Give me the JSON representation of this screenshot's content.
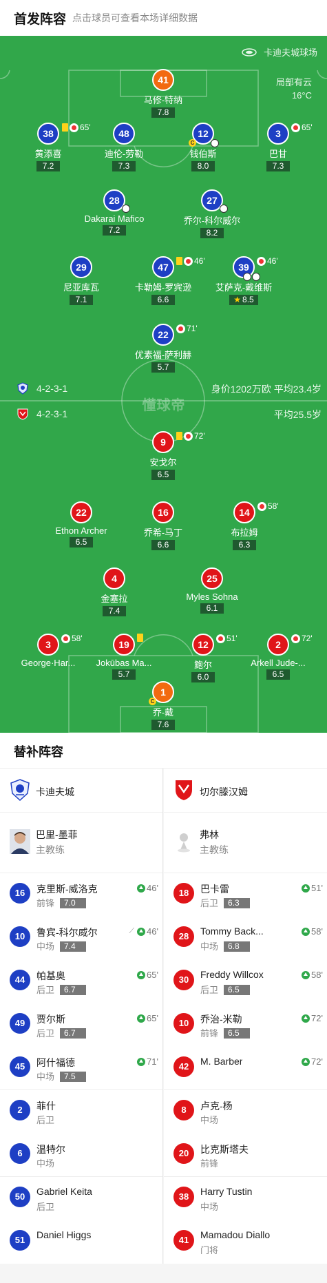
{
  "header": {
    "title": "首发阵容",
    "subtitle": "点击球员可查看本场详细数据"
  },
  "venue": "卡迪夫城球场",
  "weather": {
    "condition": "局部有云",
    "temp": "16°C"
  },
  "home": {
    "formation": "4-2-3-1",
    "meta": "身价1202万欧 平均23.4岁"
  },
  "away": {
    "formation": "4-2-3-1",
    "meta": "平均25.5岁"
  },
  "watermark": "懂球帝",
  "colors": {
    "pitch": "#31a74a",
    "home": "#1e3fc4",
    "away": "#e01519",
    "keeper": "#f26a10",
    "sub_in": "#2fa84a"
  },
  "home_players": [
    {
      "num": "41",
      "name": "马修-特纳",
      "rating": "7.8"
    },
    {
      "num": "38",
      "name": "黄添喜",
      "rating": "7.2",
      "minute": "65'"
    },
    {
      "num": "48",
      "name": "迪伦-劳勒",
      "rating": "7.3"
    },
    {
      "num": "12",
      "name": "钱伯斯",
      "rating": "8.0"
    },
    {
      "num": "3",
      "name": "巴甘",
      "rating": "7.3",
      "minute": "65'"
    },
    {
      "num": "28",
      "name": "Dakarai Mafico",
      "rating": "7.2"
    },
    {
      "num": "27",
      "name": "乔尔-科尔威尔",
      "rating": "8.2"
    },
    {
      "num": "29",
      "name": "尼亚库瓦",
      "rating": "7.1"
    },
    {
      "num": "47",
      "name": "卡勒姆-罗宾逊",
      "rating": "6.6",
      "minute": "46'"
    },
    {
      "num": "39",
      "name": "艾萨克-戴维斯",
      "rating": "8.5",
      "minute": "46'"
    },
    {
      "num": "22",
      "name": "优素福-萨利赫",
      "rating": "5.7",
      "minute": "71'"
    }
  ],
  "away_players": [
    {
      "num": "9",
      "name": "安戈尔",
      "rating": "6.5",
      "minute": "72'"
    },
    {
      "num": "22",
      "name": "Ethon Archer",
      "rating": "6.5"
    },
    {
      "num": "16",
      "name": "乔希-马丁",
      "rating": "6.6"
    },
    {
      "num": "14",
      "name": "布拉姆",
      "rating": "6.3",
      "minute": "58'"
    },
    {
      "num": "4",
      "name": "金塞拉",
      "rating": "7.4"
    },
    {
      "num": "25",
      "name": "Myles Sohna",
      "rating": "6.1"
    },
    {
      "num": "3",
      "name": "George·Har...",
      "minute": "58'"
    },
    {
      "num": "19",
      "name": "Jokūbas Ma...",
      "rating": "5.7"
    },
    {
      "num": "12",
      "name": "鲍尔",
      "rating": "6.0",
      "minute": "51'"
    },
    {
      "num": "2",
      "name": "Arkell Jude-...",
      "rating": "6.5",
      "minute": "72'"
    },
    {
      "num": "1",
      "name": "乔-戴",
      "rating": "7.6"
    }
  ],
  "subs": {
    "title": "替补阵容",
    "left": {
      "team": "卡迪夫城",
      "coach": {
        "name": "巴里-墨菲",
        "role": "主教练"
      },
      "players": [
        {
          "num": "16",
          "name": "克里斯-威洛克",
          "pos": "前锋",
          "rating": "7.0",
          "minute": "46'"
        },
        {
          "num": "10",
          "name": "鲁宾-科尔威尔",
          "pos": "中场",
          "rating": "7.4",
          "minute": "46'"
        },
        {
          "num": "44",
          "name": "帕基奥",
          "pos": "后卫",
          "rating": "6.7",
          "minute": "65'"
        },
        {
          "num": "49",
          "name": "贾尔斯",
          "pos": "后卫",
          "rating": "6.7",
          "minute": "65'"
        },
        {
          "num": "45",
          "name": "阿什福德",
          "pos": "中场",
          "rating": "7.5",
          "minute": "71'"
        },
        {
          "num": "2",
          "name": "菲什",
          "pos": "后卫"
        },
        {
          "num": "6",
          "name": "温特尔",
          "pos": "中场"
        },
        {
          "num": "50",
          "name": "Gabriel Keita",
          "pos": "后卫"
        },
        {
          "num": "51",
          "name": "Daniel Higgs",
          "pos": ""
        }
      ]
    },
    "right": {
      "team": "切尔滕汉姆",
      "coach": {
        "name": "弗林",
        "role": "主教练"
      },
      "players": [
        {
          "num": "18",
          "name": "巴卡雷",
          "pos": "后卫",
          "rating": "6.3",
          "minute": "51'"
        },
        {
          "num": "28",
          "name": "Tommy Back...",
          "pos": "中场",
          "rating": "6.8",
          "minute": "58'"
        },
        {
          "num": "30",
          "name": "Freddy Willcox",
          "pos": "后卫",
          "rating": "6.5",
          "minute": "58'"
        },
        {
          "num": "10",
          "name": "乔治-米勒",
          "pos": "前锋",
          "rating": "6.5",
          "minute": "72'"
        },
        {
          "num": "42",
          "name": "M. Barber",
          "pos": "",
          "minute": "72'"
        },
        {
          "num": "8",
          "name": "卢克-杨",
          "pos": "中场"
        },
        {
          "num": "20",
          "name": "比克斯塔夫",
          "pos": "前锋"
        },
        {
          "num": "38",
          "name": "Harry Tustin",
          "pos": "中场"
        },
        {
          "num": "41",
          "name": "Mamadou Diallo",
          "pos": "门将"
        }
      ]
    }
  }
}
